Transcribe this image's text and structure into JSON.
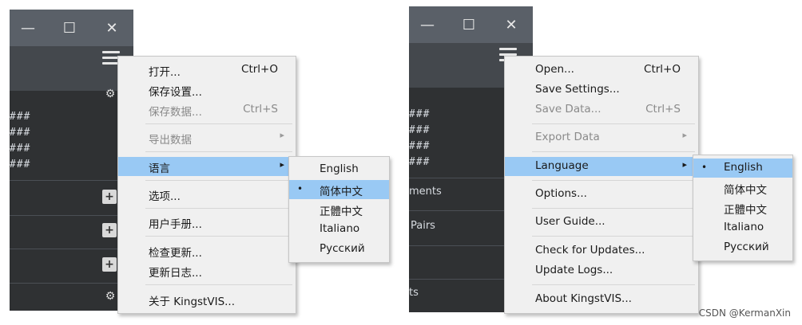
{
  "window_controls": {
    "minimize": "—",
    "maximize": "☐",
    "close": "✕"
  },
  "left": {
    "hash_lines": [
      "###",
      "###",
      "###",
      "###"
    ],
    "menu": {
      "items": [
        {
          "label": "打开...",
          "shortcut": "Ctrl+O",
          "disabled": false
        },
        {
          "label": "保存设置...",
          "shortcut": "",
          "disabled": false
        },
        {
          "label": "保存数据...",
          "shortcut": "Ctrl+S",
          "disabled": true
        },
        {
          "label": "导出数据",
          "shortcut": "",
          "disabled": true,
          "submenu": true
        },
        {
          "label": "语言",
          "shortcut": "",
          "disabled": false,
          "submenu": true,
          "highlighted": true
        },
        {
          "label": "选项...",
          "shortcut": "",
          "disabled": false
        },
        {
          "label": "用户手册...",
          "shortcut": "",
          "disabled": false
        },
        {
          "label": "检查更新...",
          "shortcut": "",
          "disabled": false
        },
        {
          "label": "更新日志...",
          "shortcut": "",
          "disabled": false
        },
        {
          "label": "关于 KingstVIS...",
          "shortcut": "",
          "disabled": false
        }
      ]
    },
    "language_submenu": {
      "items": [
        {
          "label": "English",
          "selected": false,
          "highlighted": false
        },
        {
          "label": "简体中文",
          "selected": true,
          "highlighted": true
        },
        {
          "label": "正體中文",
          "selected": false,
          "highlighted": false
        },
        {
          "label": "Italiano",
          "selected": false,
          "highlighted": false
        },
        {
          "label": "Русский",
          "selected": false,
          "highlighted": false
        }
      ]
    }
  },
  "right": {
    "hash_lines": [
      "###",
      "###",
      "###",
      "###"
    ],
    "side_labels": [
      "ments",
      "Pairs",
      "ts"
    ],
    "menu": {
      "items": [
        {
          "label": "Open...",
          "shortcut": "Ctrl+O",
          "disabled": false
        },
        {
          "label": "Save Settings...",
          "shortcut": "",
          "disabled": false
        },
        {
          "label": "Save Data...",
          "shortcut": "Ctrl+S",
          "disabled": true
        },
        {
          "label": "Export Data",
          "shortcut": "",
          "disabled": true,
          "submenu": true
        },
        {
          "label": "Language",
          "shortcut": "",
          "disabled": false,
          "submenu": true,
          "highlighted": true
        },
        {
          "label": "Options...",
          "shortcut": "",
          "disabled": false
        },
        {
          "label": "User Guide...",
          "shortcut": "",
          "disabled": false
        },
        {
          "label": "Check for Updates...",
          "shortcut": "",
          "disabled": false
        },
        {
          "label": "Update Logs...",
          "shortcut": "",
          "disabled": false
        },
        {
          "label": "About KingstVIS...",
          "shortcut": "",
          "disabled": false
        }
      ]
    },
    "language_submenu": {
      "items": [
        {
          "label": "English",
          "selected": true,
          "highlighted": true
        },
        {
          "label": "简体中文",
          "selected": false,
          "highlighted": false
        },
        {
          "label": "正體中文",
          "selected": false,
          "highlighted": false
        },
        {
          "label": "Italiano",
          "selected": false,
          "highlighted": false
        },
        {
          "label": "Русский",
          "selected": false,
          "highlighted": false
        }
      ]
    }
  },
  "watermark": "CSDN @KermanXin",
  "colors": {
    "highlight": "#99c9f4",
    "menu_bg": "#f0f0f0",
    "app_bg": "#2f3133",
    "titlebar": "#5a6068"
  },
  "icons": {
    "bullet": "•",
    "submenu_arrow": "▸",
    "gear": "⚙",
    "add": "+"
  }
}
